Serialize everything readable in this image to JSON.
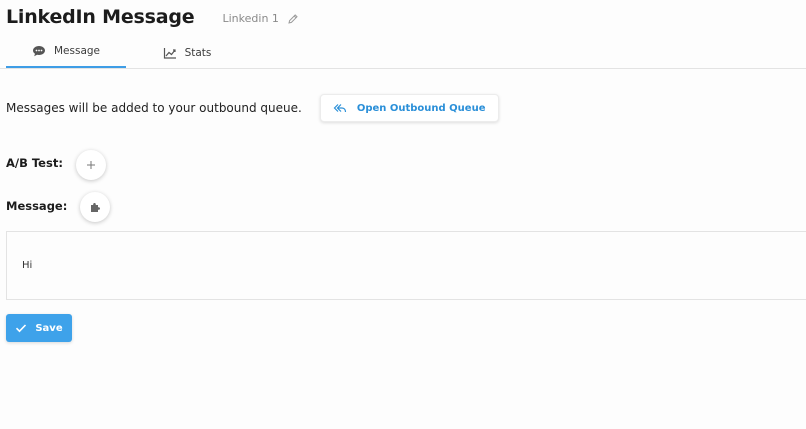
{
  "header": {
    "title": "LinkedIn Message",
    "subtitle": "Linkedin 1",
    "edit_icon": "pencil-icon"
  },
  "tabs": [
    {
      "label": "Message",
      "icon": "chat-bubble-icon",
      "active": true
    },
    {
      "label": "Stats",
      "icon": "line-chart-icon",
      "active": false
    }
  ],
  "queue": {
    "text": "Messages will be added to your outbound queue.",
    "button_label": "Open Outbound Queue",
    "button_icon": "reply-all-icon"
  },
  "ab_test": {
    "label": "A/B Test:",
    "add_icon": "plus-icon"
  },
  "message": {
    "label": "Message:",
    "snippet_icon": "puzzle-piece-icon",
    "body": "Hi"
  },
  "save": {
    "label": "Save",
    "icon": "check-icon"
  },
  "colors": {
    "accent": "#3ea2ea",
    "link": "#2a8fd8",
    "tab_underline": "#3e9de6"
  }
}
